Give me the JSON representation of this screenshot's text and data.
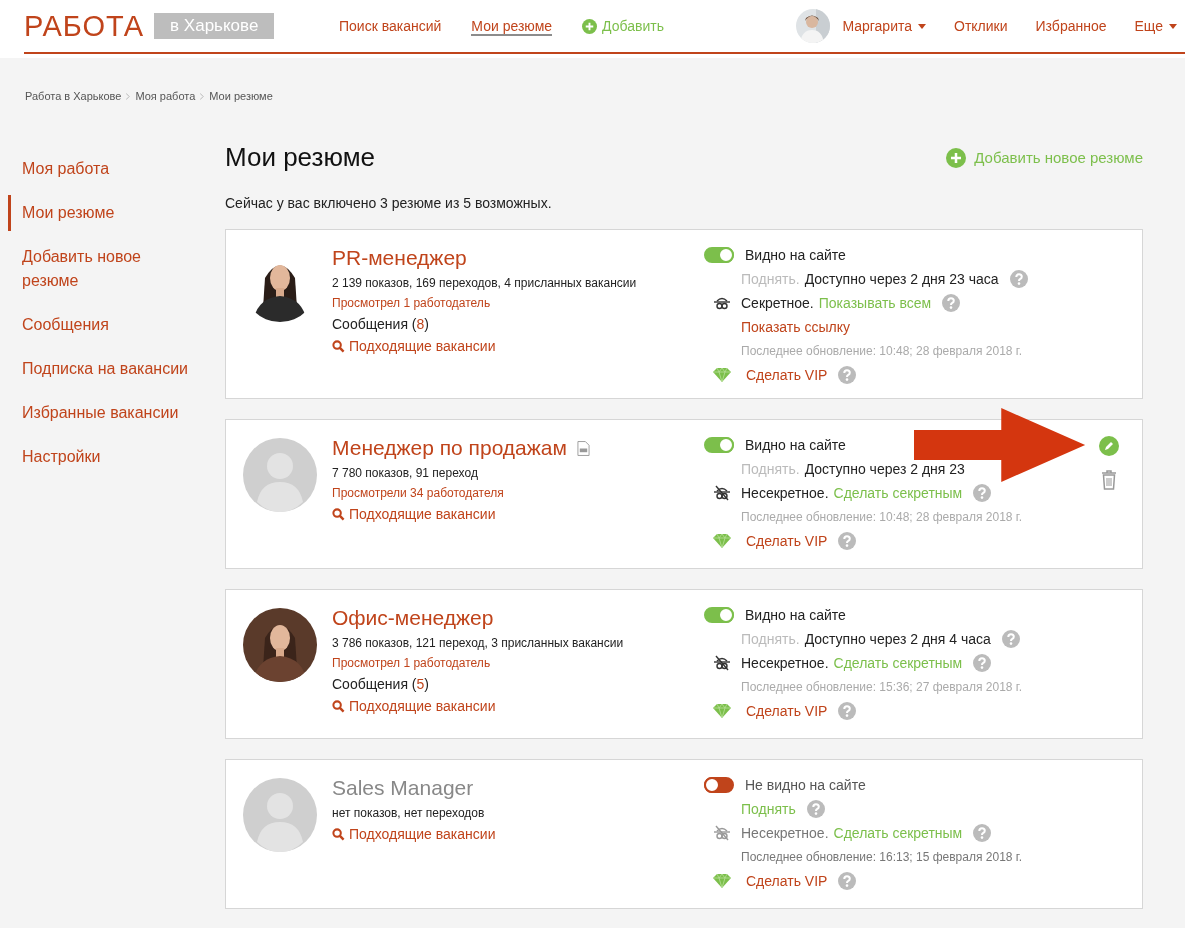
{
  "header": {
    "logo": "РАБОТА",
    "city": "в Харькове",
    "nav": [
      {
        "label": "Поиск вакансий",
        "selected": false
      },
      {
        "label": "Мои резюме",
        "selected": true
      }
    ],
    "add": "Добавить",
    "user": "Маргарита",
    "links": [
      "Отклики",
      "Избранное"
    ],
    "more": "Еще"
  },
  "breadcrumbs": [
    "Работа в Харькове",
    "Моя работа",
    "Мои резюме"
  ],
  "sidebar": {
    "items": [
      {
        "label": "Моя работа",
        "selected": false
      },
      {
        "label": "Мои резюме",
        "selected": true
      },
      {
        "label": "Добавить новое резюме",
        "selected": false
      },
      {
        "label": "Сообщения",
        "selected": false
      },
      {
        "label": "Подписка на вакансии",
        "selected": false
      },
      {
        "label": "Избранные вакансии",
        "selected": false
      },
      {
        "label": "Настройки",
        "selected": false
      }
    ]
  },
  "page": {
    "title": "Мои резюме",
    "add_new": "Добавить новое резюме",
    "summary": "Сейчас у вас включено 3 резюме из 5 возможных."
  },
  "resumes": [
    {
      "title": "PR-менеджер",
      "active": true,
      "document_icon": false,
      "stats": "2 139 показов, 169 переходов, 4 присланных вакансии",
      "viewed": "Просмотрел 1 работодатель",
      "messages": {
        "label": "Сообщения",
        "open": "(",
        "count": "8",
        "close": ")"
      },
      "matching": "Подходящие вакансии",
      "visible": true,
      "visibility": "Видно на сайте",
      "raise": {
        "label": "Поднять.",
        "available": false,
        "wait": "Доступно через 2 дня 23 часа",
        "help": true
      },
      "secret": true,
      "secret_status": "Секретное.",
      "secret_action": "Показывать всем",
      "show_link": "Показать ссылку",
      "updated": "Последнее обновление: 10:48; 28 февраля 2018 г.",
      "vip": "Сделать VIP",
      "actions": false
    },
    {
      "kind": "placeholder",
      "title": "Менеджер по продажам",
      "active": true,
      "document_icon": true,
      "stats": "7 780 показов, 91 переход",
      "viewed": "Просмотрели 34 работодателя",
      "matching": "Подходящие вакансии",
      "visible": true,
      "visibility": "Видно на сайте",
      "raise": {
        "label": "Поднять.",
        "available": false,
        "wait": "Доступно через 2 дня 23",
        "help": false
      },
      "secret": false,
      "secret_status": "Несекретное.",
      "secret_action": "Сделать секретным",
      "updated": "Последнее обновление: 10:48; 28 февраля 2018 г.",
      "vip": "Сделать VIP",
      "actions": true
    },
    {
      "title": "Офис-менеджер",
      "active": true,
      "document_icon": false,
      "stats": "3 786 показов, 121 переход, 3 присланных вакансии",
      "viewed": "Просмотрел 1 работодатель",
      "messages": {
        "label": "Сообщения",
        "open": "(",
        "count": "5",
        "close": ")"
      },
      "matching": "Подходящие вакансии",
      "visible": true,
      "visibility": "Видно на сайте",
      "raise": {
        "label": "Поднять.",
        "available": false,
        "wait": "Доступно через 2 дня 4 часа",
        "help": true
      },
      "secret": false,
      "secret_status": "Несекретное.",
      "secret_action": "Сделать секретным",
      "updated": "Последнее обновление: 15:36; 27 февраля 2018 г.",
      "vip": "Сделать VIP",
      "actions": false
    },
    {
      "kind": "placeholder",
      "title": "Sales Manager",
      "active": false,
      "document_icon": false,
      "stats": "нет показов, нет переходов",
      "matching": "Подходящие вакансии",
      "visible": false,
      "visibility": "Не видно на сайте",
      "raise": {
        "label": "Поднять",
        "available": true,
        "help": true
      },
      "secret": false,
      "secret_status": "Несекретное.",
      "secret_action": "Сделать секретным",
      "updated": "Последнее обновление: 16:13; 15 февраля 2018 г.",
      "vip": "Сделать VIP",
      "actions": false
    }
  ]
}
